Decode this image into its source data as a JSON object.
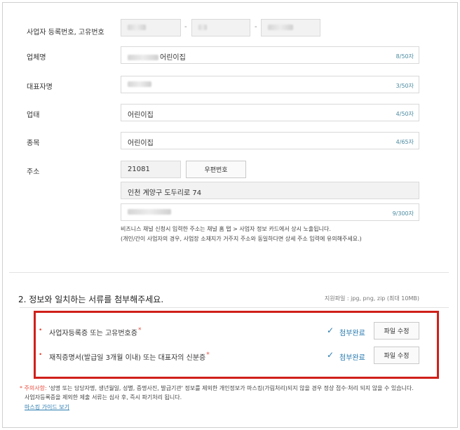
{
  "form": {
    "biz_number_label": "사업자 등록번호, 고유번호",
    "biz_number_dash1": "-",
    "biz_number_dash2": "-",
    "company_label": "업체명",
    "company_value": "어린이집",
    "company_count": "8/50자",
    "ceo_label": "대표자명",
    "ceo_count": "3/50자",
    "business_type_label": "업태",
    "business_type_value": "어린이집",
    "business_type_count": "4/50자",
    "item_label": "종목",
    "item_value": "어린이집",
    "item_count": "4/65자",
    "address_label": "주소",
    "zipcode": "21081",
    "zipcode_button": "우편번호",
    "address1": "인천 계양구 도두리로 74",
    "address2_count": "9/300자",
    "address_note1": "비즈니스 채널 신청시 입력한 주소는 채널 홈 탭 > 사업자 정보 카드에서 상시 노출됩니다.",
    "address_note2": "(개인/간이 사업자의 경우, 사업장 소재지가 거주지 주소와 동일하다면 상세 주소 입력에 유의해주세요.)"
  },
  "attach": {
    "title": "2. 정보와 일치하는 서류를 첨부해주세요.",
    "file_hint": "지원파일 : jpg, png, zip (최대 10MB)",
    "required_mark": "*",
    "bullet": "•",
    "check_icon": "check-icon",
    "docs": [
      {
        "label": "사업자등록증 또는 고유번호증",
        "status": "첨부완료",
        "button": "파일 수정"
      },
      {
        "label": "재직증명서(발급일 3개월 이내) 또는 대표자의 신분증",
        "status": "첨부완료",
        "button": "파일 수정"
      }
    ]
  },
  "caution": {
    "prefix": "* 주의사항:",
    "line1": " '성명 또는 담당자명, 생년월일, 성별, 증명사진, 발급기관' 정보를 제외한 개인정보가 마스킹(가림처리)되지 않을 경우 정상 접수·처리 되지 않을 수 있습니다.",
    "line2": "사업자등록증을 제외한 제출 서류는 심사 후, 즉시 파기처리 됩니다.",
    "guide_link": "마스킹 가이드 보기"
  },
  "colors": {
    "accent": "#2a7bb0",
    "warning": "#e84a3b",
    "highlight_border": "#d0201a"
  }
}
